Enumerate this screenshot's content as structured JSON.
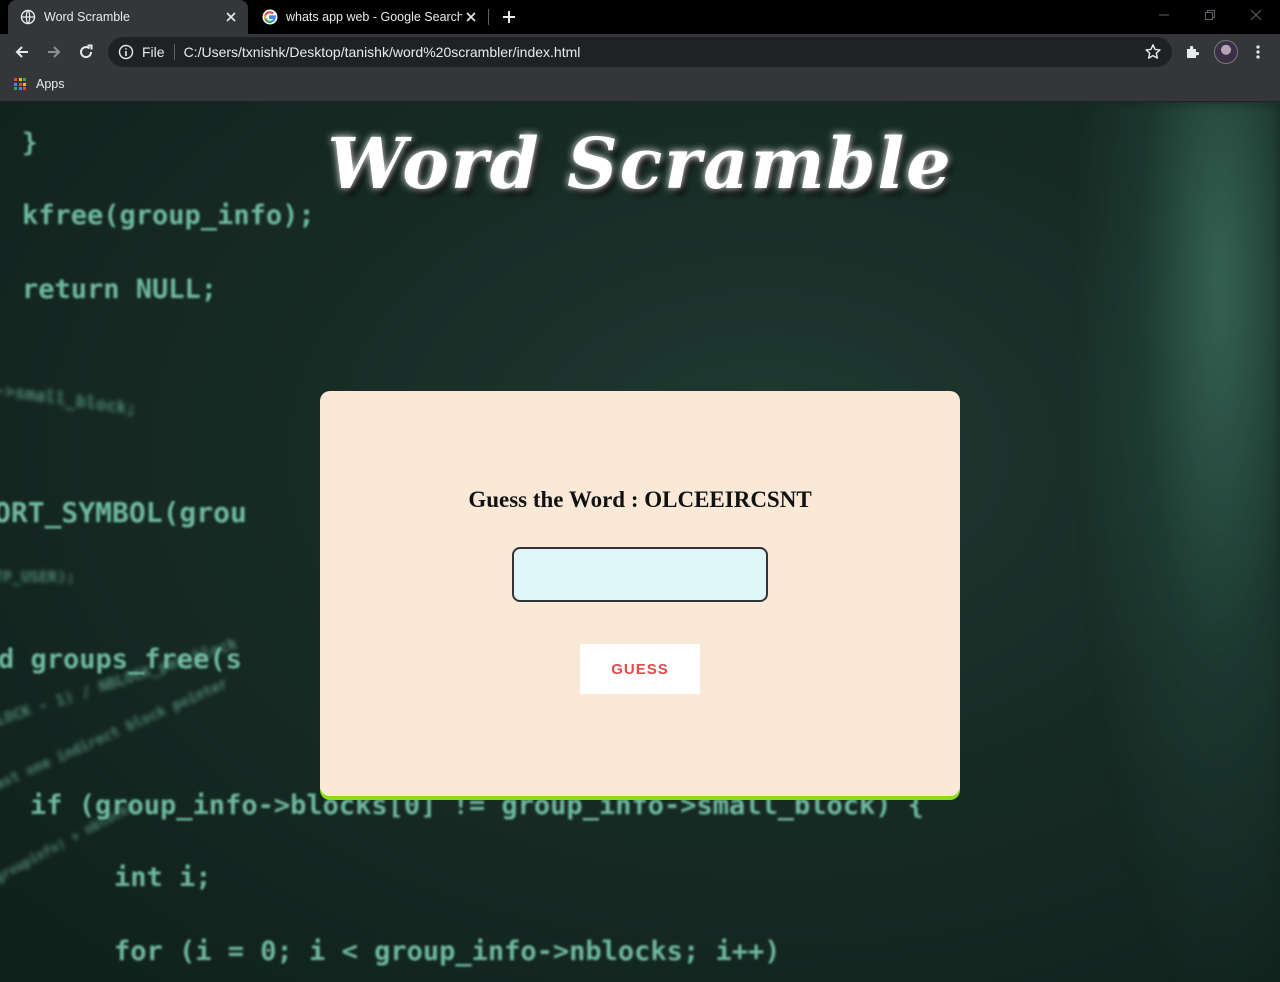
{
  "browser": {
    "tabs": [
      {
        "title": "Word Scramble",
        "active": true,
        "favicon": "globe-icon"
      },
      {
        "title": "whats app web - Google Search",
        "active": false,
        "favicon": "google-icon"
      }
    ],
    "address_bar": {
      "scheme_label": "File",
      "url": "C:/Users/txnishk/Desktop/tanishk/word%20scrambler/index.html"
    },
    "bookmarks": [
      {
        "label": "Apps",
        "icon": "apps-grid-icon"
      }
    ],
    "colors": {
      "tabstrip": "#000000",
      "toolbar": "#35363a",
      "omnibox": "#202124"
    }
  },
  "page": {
    "heading": "Word Scramble",
    "prompt": "Guess the Word : OLCEEIRCSNT",
    "input": {
      "value": "",
      "placeholder": ""
    },
    "button_label": "GUESS",
    "colors": {
      "card": "#fbe9d7",
      "card_accent": "#8bdc1e",
      "input_bg": "#dff6fb",
      "button_text": "#e44a4a"
    },
    "background_code": {
      "lines": [
        "}",
        "kfree(group_info);",
        "return NULL;",
        "ORT_SYMBOL(grou",
        "d groups_free(s",
        "if (group_info->blocks[0] != group_info->small_block) {",
        "int i;",
        "for (i = 0; i < group_info->nblocks; i++)"
      ],
      "blurred_lines": [
        "->small_block;",
        "TP_USER);",
        "LOCK - 1) / NBLOCK_per_block",
        "ast one indirect block pointer",
        "groupinfo) + nblocks"
      ]
    }
  }
}
